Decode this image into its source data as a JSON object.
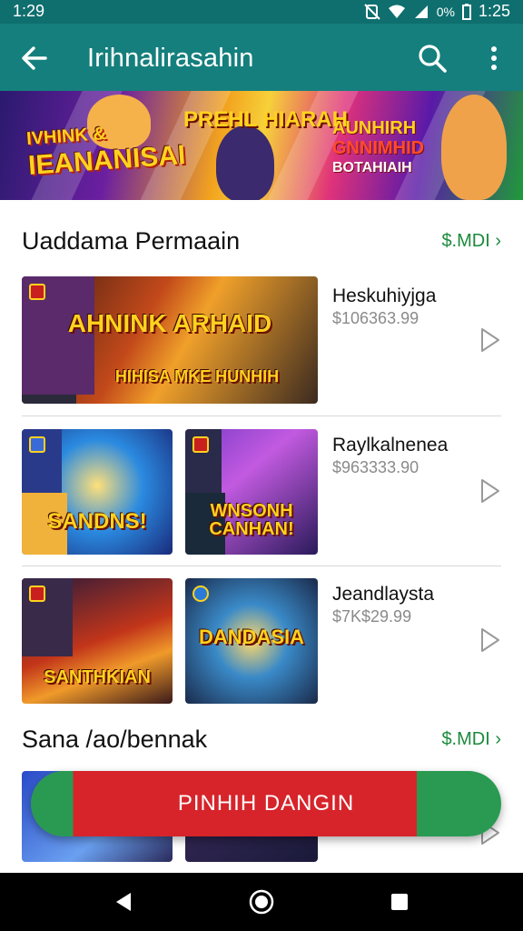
{
  "status_bar": {
    "time_left": "1:29",
    "battery": "0%",
    "time_right": "1:25"
  },
  "app_bar": {
    "title": "Irihnalirasahin"
  },
  "banner": {
    "left_line1": "IVHINK & ",
    "left_line2": "IEANANISAI",
    "center_title": "PREHL HIARAH",
    "right_line1": "AUNHIRH",
    "right_line2": "GNNIMHID",
    "right_line3": "BOTAHIAIH"
  },
  "section1": {
    "title": "Uaddama Permaain",
    "more_label": "$.MDI",
    "items": [
      {
        "name": "Heskuhiyjga",
        "price": "$106363.99",
        "thumb1_title": "AHNINK ARHAID",
        "thumb1_sub": "HIHISA MKE HUNHIH"
      },
      {
        "name": "Raylkalnenea",
        "price": "$963333.90",
        "thumb1_title": "SANDNS!",
        "thumb2_title": "WNSONH CANHAN!"
      },
      {
        "name": "Jeandlaysta",
        "price": "$7K$29.99",
        "thumb1_title": "SANTHKIAN",
        "thumb2_title": "DANDASIA"
      }
    ]
  },
  "section2": {
    "title": "Sana /ao/bennak",
    "more_label": "$.MDI"
  },
  "cta": {
    "label": "PINHIH DANGIN"
  },
  "colors": {
    "app_bar": "#157f7d",
    "status_bar": "#0e6f6e",
    "accent_green": "#1c8a3c",
    "cta_red": "#d6242a"
  },
  "icons": [
    "arrow-back-icon",
    "search-icon",
    "more-vert-icon",
    "play-arrow-icon",
    "nav-back-icon",
    "nav-home-icon",
    "nav-recents-icon"
  ]
}
